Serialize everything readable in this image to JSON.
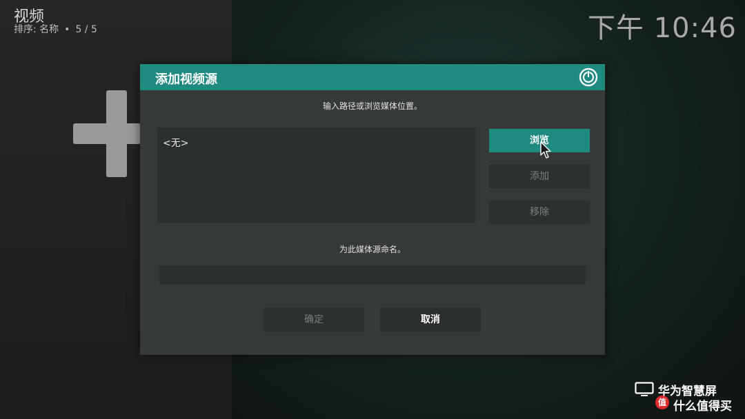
{
  "header": {
    "title": "视频",
    "sort_label": "排序: 名称",
    "separator": "•",
    "count": "5 / 5"
  },
  "clock": "下午 10:46",
  "dialog": {
    "title": "添加视频源",
    "prompt_path": "输入路径或浏览媒体位置。",
    "path_value": "<无>",
    "browse_label": "浏览",
    "add_label": "添加",
    "remove_label": "移除",
    "prompt_name": "为此媒体源命名。",
    "name_value": "",
    "ok_label": "确定",
    "cancel_label": "取消"
  },
  "watermark": {
    "line1": "华为智慧屏",
    "badge": "值",
    "line2": "什么值得买"
  },
  "colors": {
    "accent": "#1f8a80",
    "dialog_bg": "#353a38",
    "field_bg": "#2b302e",
    "disabled_text": "#7b7f7d"
  },
  "icons": {
    "close": "power-icon",
    "add_source": "plus-icon",
    "cursor": "mouse-pointer-icon",
    "tv": "tv-icon"
  }
}
